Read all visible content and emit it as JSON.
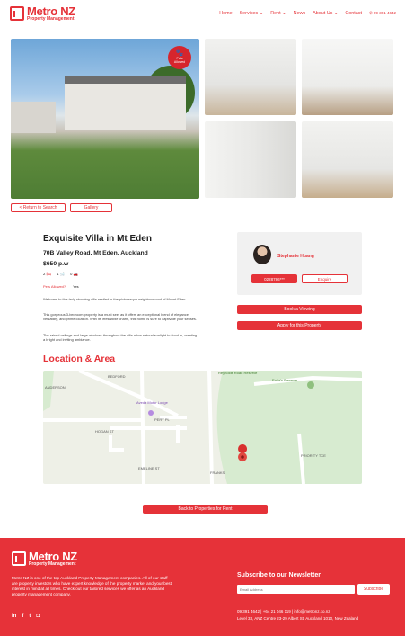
{
  "brand": {
    "name": "Metro NZ",
    "tagline": "Property Management"
  },
  "nav": {
    "items": [
      "Home",
      "Services",
      "Rent",
      "News",
      "About Us",
      "Contact"
    ],
    "phone": "09 391 4642"
  },
  "gallery": {
    "badge_line1": "Pets",
    "badge_line2": "Allowed",
    "return_label": "< Return to Search",
    "gallery_label": "Gallery"
  },
  "listing": {
    "title": "Exquisite Villa in Mt Eden",
    "address": "70B Valley Road, Mt Eden, Auckland",
    "price": "$650 p.w",
    "bedrooms": "2",
    "bathrooms": "1",
    "parking": "0",
    "pets_label": "Pets Allowed?",
    "pets_value": "Yes",
    "desc1": "Welcome to this truly stunning villa nestled in the picturesque neighbourhood of Mount Eden.",
    "desc2": "This gorgeous 3-bedroom property is a must see, as it offers an exceptional blend of elegance, versatility, and prime location. With its irresistible charm, this home is sure to captivate your senses.",
    "desc3": "The raised ceilings and large windows throughout the villa allow natural sunlight to flood in, creating a bright and inviting ambiance."
  },
  "agent": {
    "name": "Stephanie Huang",
    "phone": "0228786***",
    "enquire": "Enquire"
  },
  "actions": {
    "viewing": "Book a Viewing",
    "apply": "Apply for this Property",
    "back": "Back to Properties for Rent"
  },
  "location": {
    "title": "Location & Area",
    "labels": [
      "Reynolds Road Reserve",
      "Ernie's Reserve",
      "Aveda Motor Lodge",
      "HOGAN ST",
      "PERY PL",
      "BEDFORD",
      "ANDERSON",
      "EMELINE ST",
      "FRANKS",
      "PRIORITY TCE"
    ]
  },
  "footer": {
    "description": "Metro NZ is one of the top Auckland Property Management companies. All of our staff are property investors who have expert knowledge of the property market and your best interest in mind at all times. Check out our tailored services we offer as an Auckland property management company.",
    "social": [
      "in",
      "f",
      "t",
      "ig"
    ],
    "newsletter_title": "Subscribe to our Newsletter",
    "email_placeholder": "Email Address",
    "subscribe": "Subscribe",
    "contact_line1": "09 391 4642  |  +64 21 046 119  |  info@metronz.co.nz",
    "contact_line2": "Level 33, ANZ Centre 23-29 Albert St, Auckland 1010, New Zealand"
  },
  "colors": {
    "accent": "#e53238"
  }
}
